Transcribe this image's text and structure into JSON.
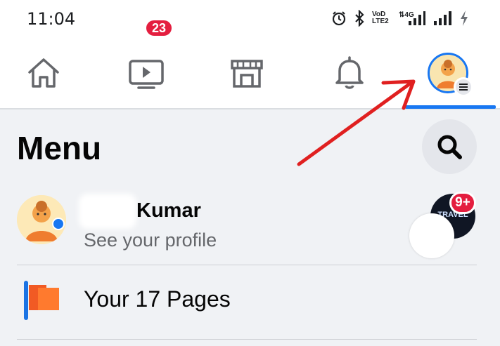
{
  "status_bar": {
    "time": "11:04",
    "icons": [
      "alarm-icon",
      "bluetooth-icon",
      "volte-icon",
      "signal-4g-icon",
      "signal-icon",
      "charging-icon"
    ],
    "volte_text": "VoD LTE2",
    "network_text": "4G"
  },
  "nav": {
    "tabs": [
      {
        "name": "home",
        "icon": "home-icon"
      },
      {
        "name": "watch",
        "icon": "video-icon",
        "badge": "23"
      },
      {
        "name": "marketplace",
        "icon": "marketplace-icon"
      },
      {
        "name": "notifications",
        "icon": "bell-icon"
      },
      {
        "name": "menu",
        "icon": "profile-avatar-icon",
        "active": true
      }
    ],
    "active_color": "#1877f2",
    "badge_color": "#e41e3f"
  },
  "menu": {
    "title": "Menu"
  },
  "profile": {
    "name": "Kumar",
    "subtitle": "See your profile",
    "right_badge": "9+",
    "thumb_text": "TRAVEL"
  },
  "shortcuts": [
    {
      "label": "Your 17 Pages",
      "icon": "pages-flag-icon"
    }
  ],
  "annotation": {
    "arrow_color": "#e02020"
  }
}
